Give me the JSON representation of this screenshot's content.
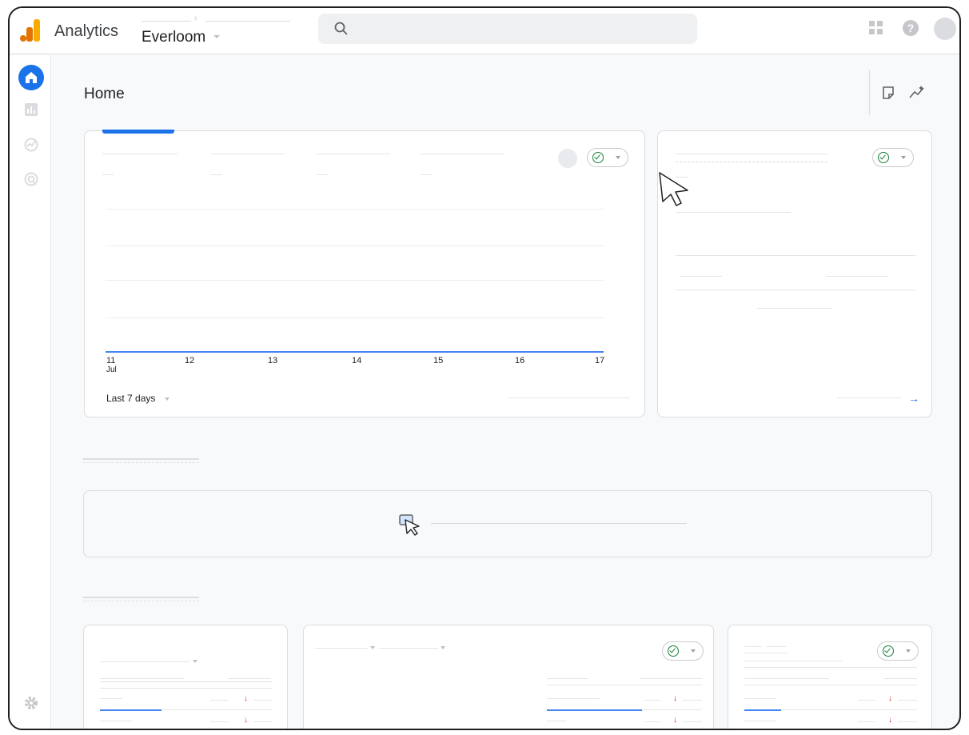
{
  "app": {
    "name": "Analytics"
  },
  "header": {
    "property": "Everloom"
  },
  "page": {
    "title": "Home"
  },
  "overview_chart": {
    "x_ticks": [
      "11",
      "12",
      "13",
      "14",
      "15",
      "16",
      "17"
    ],
    "x_month": "Jul",
    "date_range": "Last 7 days"
  },
  "icons": {
    "search": "search-icon",
    "apps": "apps-grid-icon",
    "help": "help-icon",
    "home": "home-icon",
    "reports": "reports-icon",
    "explore": "explore-icon",
    "advertising": "advertising-icon",
    "settings": "gear-icon",
    "note": "note-icon",
    "insights": "insights-icon",
    "status": "check-circle-icon",
    "arrow": "arrow-right-icon",
    "down": "arrow-down-icon"
  },
  "colors": {
    "accent": "#1a73e8",
    "brand_orange": "#f9ab00",
    "brand_dark_orange": "#e37400",
    "status_green": "#188038",
    "negative": "#c5221f"
  }
}
